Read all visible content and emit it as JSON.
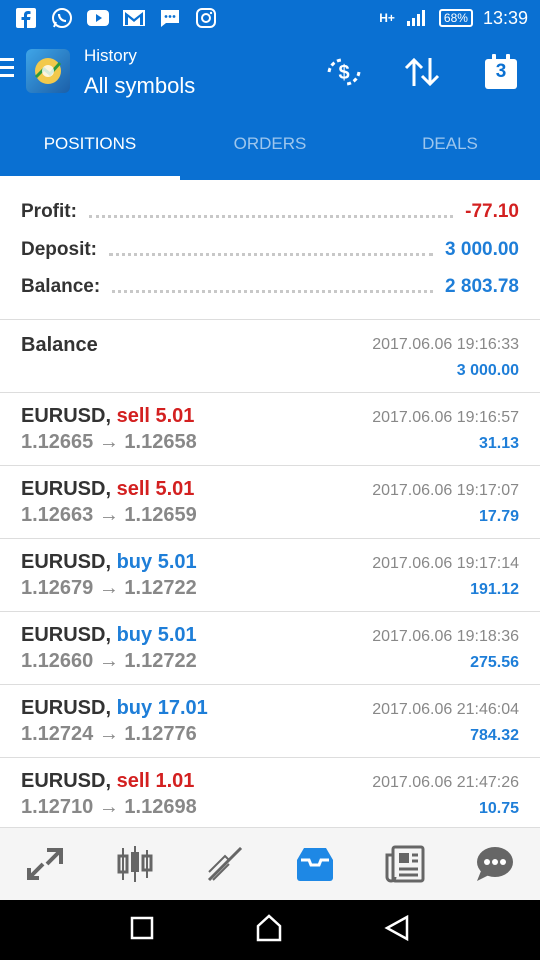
{
  "status_bar": {
    "network": "H+",
    "battery": "68%",
    "time": "13:39",
    "icons": [
      "facebook-icon",
      "whatsapp-icon",
      "youtube-icon",
      "gmail-icon",
      "messages-icon",
      "instagram-icon"
    ]
  },
  "app_bar": {
    "title_small": "History",
    "title_big": "All symbols",
    "calendar_day": "3"
  },
  "tabs": [
    {
      "label": "POSITIONS",
      "active": true
    },
    {
      "label": "ORDERS",
      "active": false
    },
    {
      "label": "DEALS",
      "active": false
    }
  ],
  "summary": {
    "profit_label": "Profit:",
    "profit_value": "-77.10",
    "deposit_label": "Deposit:",
    "deposit_value": "3 000.00",
    "balance_label": "Balance:",
    "balance_value": "2 803.78"
  },
  "entries": [
    {
      "symbol": "Balance",
      "type": "",
      "prices": "",
      "time": "2017.06.06 19:16:33",
      "profit": "3 000.00"
    },
    {
      "symbol": "EURUSD,",
      "type": "sell 5.01",
      "side": "sell",
      "prices": "1.12665 → 1.12658",
      "time": "2017.06.06 19:16:57",
      "profit": "31.13"
    },
    {
      "symbol": "EURUSD,",
      "type": "sell 5.01",
      "side": "sell",
      "prices": "1.12663 → 1.12659",
      "time": "2017.06.06 19:17:07",
      "profit": "17.79"
    },
    {
      "symbol": "EURUSD,",
      "type": "buy 5.01",
      "side": "buy",
      "prices": "1.12679 → 1.12722",
      "time": "2017.06.06 19:17:14",
      "profit": "191.12"
    },
    {
      "symbol": "EURUSD,",
      "type": "buy 5.01",
      "side": "buy",
      "prices": "1.12660 → 1.12722",
      "time": "2017.06.06 19:18:36",
      "profit": "275.56"
    },
    {
      "symbol": "EURUSD,",
      "type": "buy 17.01",
      "side": "buy",
      "prices": "1.12724 → 1.12776",
      "time": "2017.06.06 21:46:04",
      "profit": "784.32"
    },
    {
      "symbol": "EURUSD,",
      "type": "sell 1.01",
      "side": "sell",
      "prices": "1.12710 → 1.12698",
      "time": "2017.06.06 21:47:26",
      "profit": "10.75"
    }
  ],
  "bottom_nav": [
    "quotes-icon",
    "chart-icon",
    "trade-icon",
    "history-icon",
    "news-icon",
    "chat-icon"
  ],
  "colors": {
    "primary": "#0a70d2",
    "sell": "#d32020",
    "buy": "#1e7ed8",
    "negative": "#d32020"
  }
}
